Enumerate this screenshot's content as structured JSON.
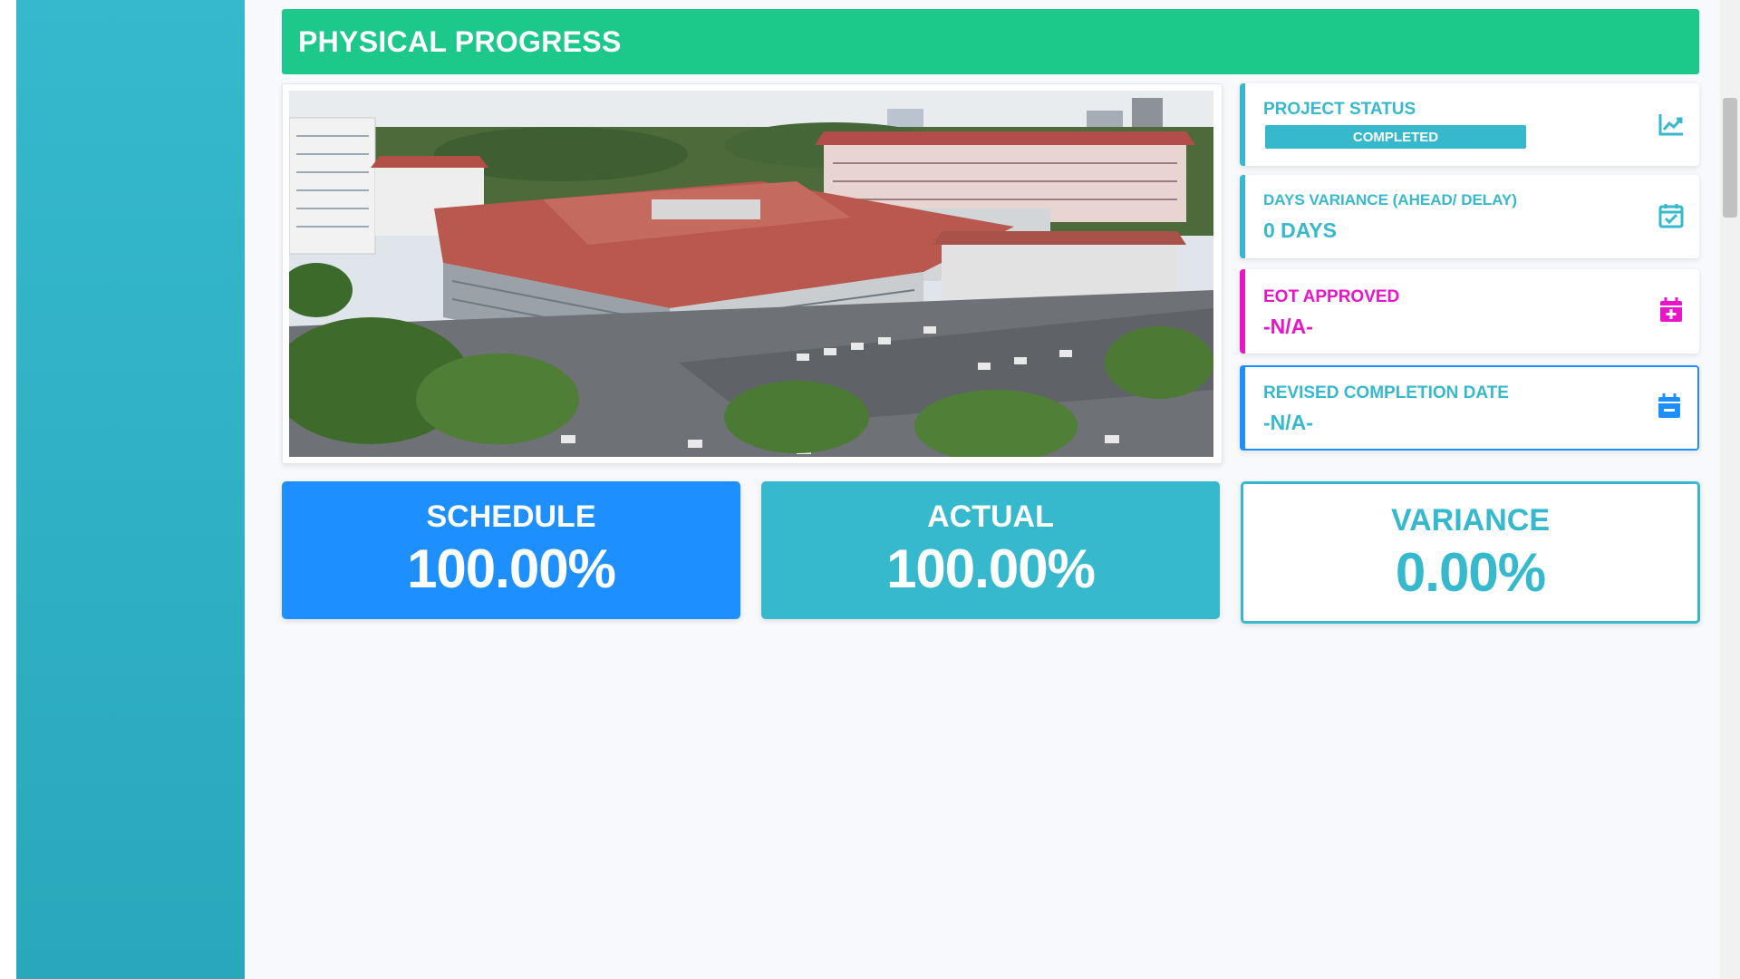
{
  "section": {
    "title": "PHYSICAL PROGRESS"
  },
  "photo": {
    "alt": "hospital-aerial-photo"
  },
  "project_status": {
    "label": "PROJECT STATUS",
    "badge": "COMPLETED",
    "icon": "chart-line-icon"
  },
  "days_variance": {
    "label": "DAYS VARIANCE (AHEAD/ DELAY)",
    "value": "0 DAYS",
    "icon": "calendar-check-icon"
  },
  "eot_approved": {
    "label": "EOT APPROVED",
    "value": "-N/A-",
    "icon": "calendar-plus-icon"
  },
  "revised_completion": {
    "label": "REVISED COMPLETION DATE",
    "value": "-N/A-",
    "icon": "calendar-minus-icon"
  },
  "schedule": {
    "label": "SCHEDULE",
    "value": "100.00%"
  },
  "actual": {
    "label": "ACTUAL",
    "value": "100.00%"
  },
  "variance": {
    "label": "VARIANCE",
    "value": "0.00%"
  },
  "colors": {
    "sidebar": "#36b9cc",
    "header": "#1cc88a",
    "info": "#36b9cc",
    "eot": "#e815c9",
    "primary": "#1e8fff"
  }
}
